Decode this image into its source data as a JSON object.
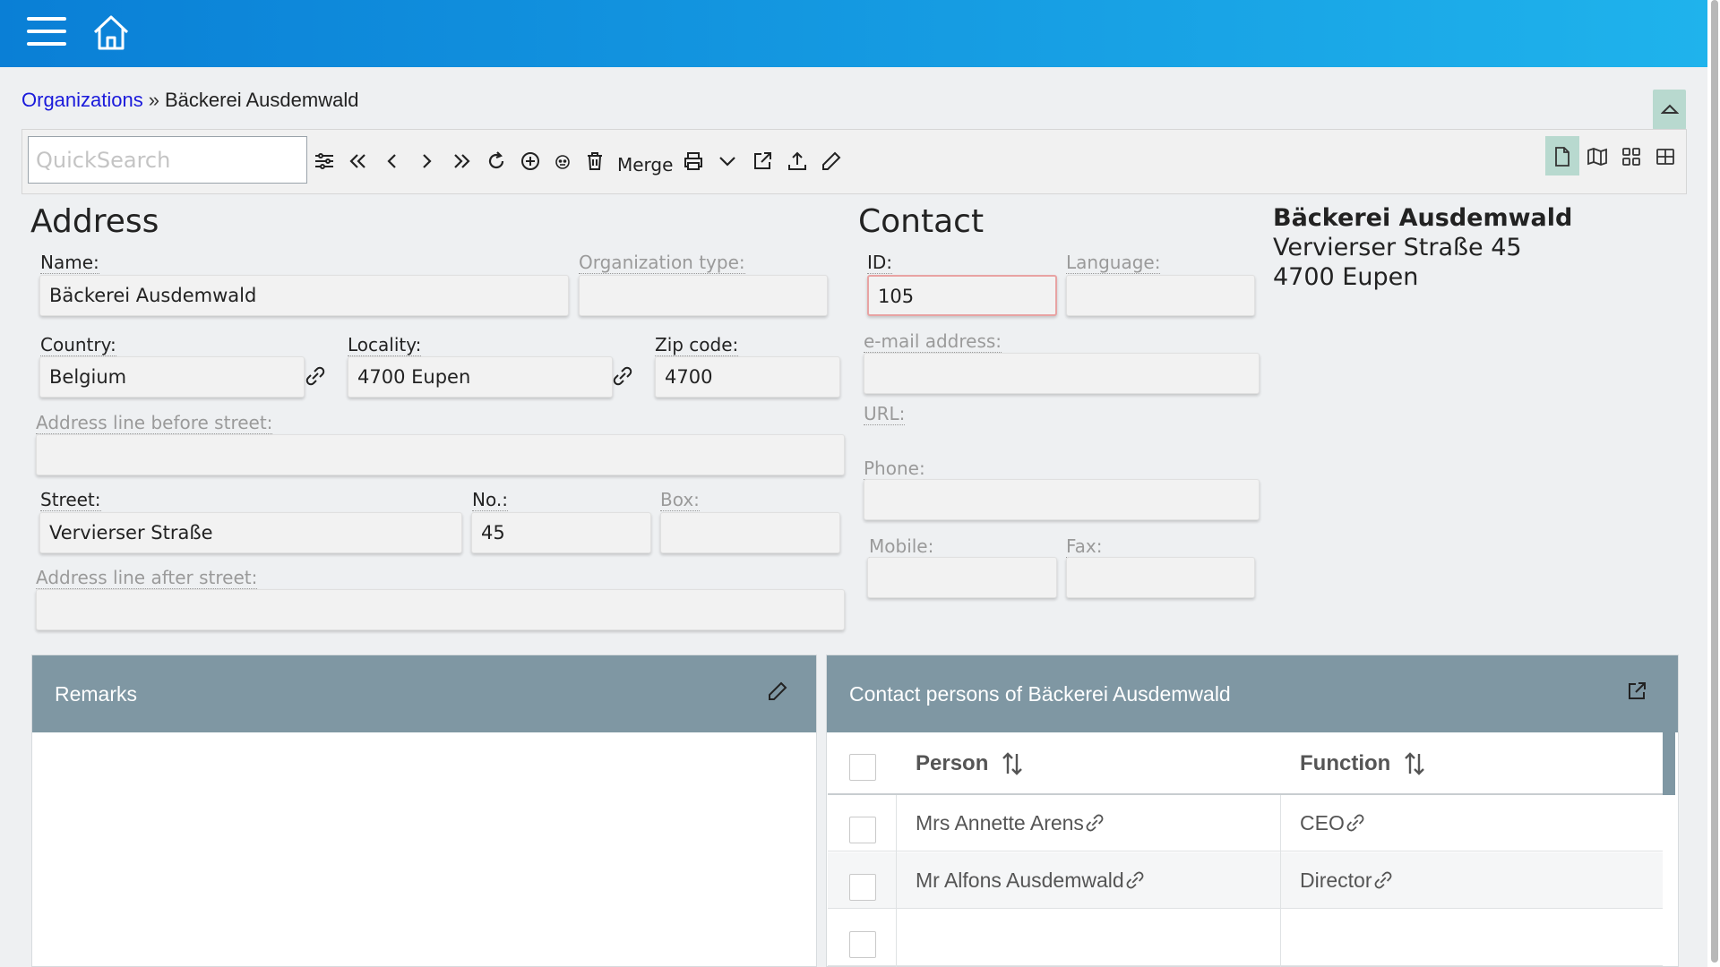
{
  "header": {
    "menu_icon": "hamburger-icon",
    "home_icon": "home-icon"
  },
  "breadcrumb": {
    "parent": "Organizations",
    "separator": "»",
    "current": "Bäckerei Ausdemwald"
  },
  "toolbar": {
    "search_placeholder": "QuickSearch",
    "merge_label": "Merge",
    "icons": [
      "filter-icon",
      "first-icon",
      "prev-icon",
      "next-icon",
      "last-icon",
      "refresh-icon",
      "insert-icon",
      "duplicate-icon",
      "delete-icon",
      "print-icon",
      "more-icon",
      "open-external-icon",
      "export-icon",
      "edit-icon"
    ],
    "view_modes": [
      "detail-view-icon",
      "map-view-icon",
      "cards-view-icon",
      "grid-view-icon"
    ]
  },
  "address": {
    "title": "Address",
    "name_label": "Name:",
    "name_value": "Bäckerei Ausdemwald",
    "org_type_label": "Organization type:",
    "org_type_value": "",
    "country_label": "Country:",
    "country_value": "Belgium",
    "locality_label": "Locality:",
    "locality_value": "4700 Eupen",
    "zip_label": "Zip code:",
    "zip_value": "4700",
    "addr_before_label": "Address line before street:",
    "addr_before_value": "",
    "street_label": "Street:",
    "street_value": "Vervierser Straße",
    "no_label": "No.:",
    "no_value": "45",
    "box_label": "Box:",
    "box_value": "",
    "addr_after_label": "Address line after street:",
    "addr_after_value": ""
  },
  "contact": {
    "title": "Contact",
    "id_label": "ID:",
    "id_value": "105",
    "language_label": "Language:",
    "language_value": "",
    "email_label": "e-mail address:",
    "email_value": "",
    "url_label": "URL:",
    "phone_label": "Phone:",
    "phone_value": "",
    "mobile_label": "Mobile:",
    "mobile_value": "",
    "fax_label": "Fax:",
    "fax_value": ""
  },
  "summary": {
    "name": "Bäckerei Ausdemwald",
    "street": "Vervierser Straße 45",
    "city": "4700 Eupen"
  },
  "remarks": {
    "title": "Remarks"
  },
  "contacts_panel": {
    "title": "Contact persons of Bäckerei Ausdemwald",
    "columns": [
      "Person",
      "Function"
    ],
    "rows": [
      {
        "person": "Mrs Annette Arens",
        "function": "CEO"
      },
      {
        "person": "Mr Alfons Ausdemwald",
        "function": "Director"
      },
      {
        "person": "",
        "function": ""
      }
    ]
  }
}
